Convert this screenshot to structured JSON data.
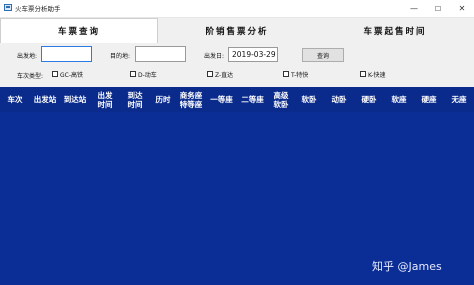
{
  "window": {
    "title": "火车票分析助手",
    "controls": [
      "—",
      "☐",
      "✕"
    ]
  },
  "tabs": [
    {
      "label": "车票查询",
      "active": true
    },
    {
      "label": "阶销售票分析",
      "active": false
    },
    {
      "label": "车票起售时间",
      "active": false
    }
  ],
  "query": {
    "from_label": "出发地:",
    "from_value": "",
    "to_label": "目的地:",
    "to_value": "",
    "date_label": "出发日:",
    "date_value": "2019-03-29",
    "submit_label": "查询",
    "train_type_label": "车次类型:",
    "train_types": [
      {
        "label": "GC-高铁",
        "checked": false
      },
      {
        "label": "D-动车",
        "checked": false
      },
      {
        "label": "Z-直达",
        "checked": false
      },
      {
        "label": "T-特快",
        "checked": false
      },
      {
        "label": "K-快速",
        "checked": false
      }
    ]
  },
  "table": {
    "columns": [
      "车次",
      "出发站",
      "到达站",
      "出发\n时间",
      "到达\n时间",
      "历时",
      "商务座\n特等座",
      "一等座",
      "二等座",
      "高级\n软卧",
      "软卧",
      "动卧",
      "硬卧",
      "软座",
      "硬座",
      "无座"
    ],
    "rows": []
  },
  "watermark": "知乎 @James",
  "colors": {
    "grid_background": "#0b2d96",
    "focus_border": "#2c7be5"
  }
}
